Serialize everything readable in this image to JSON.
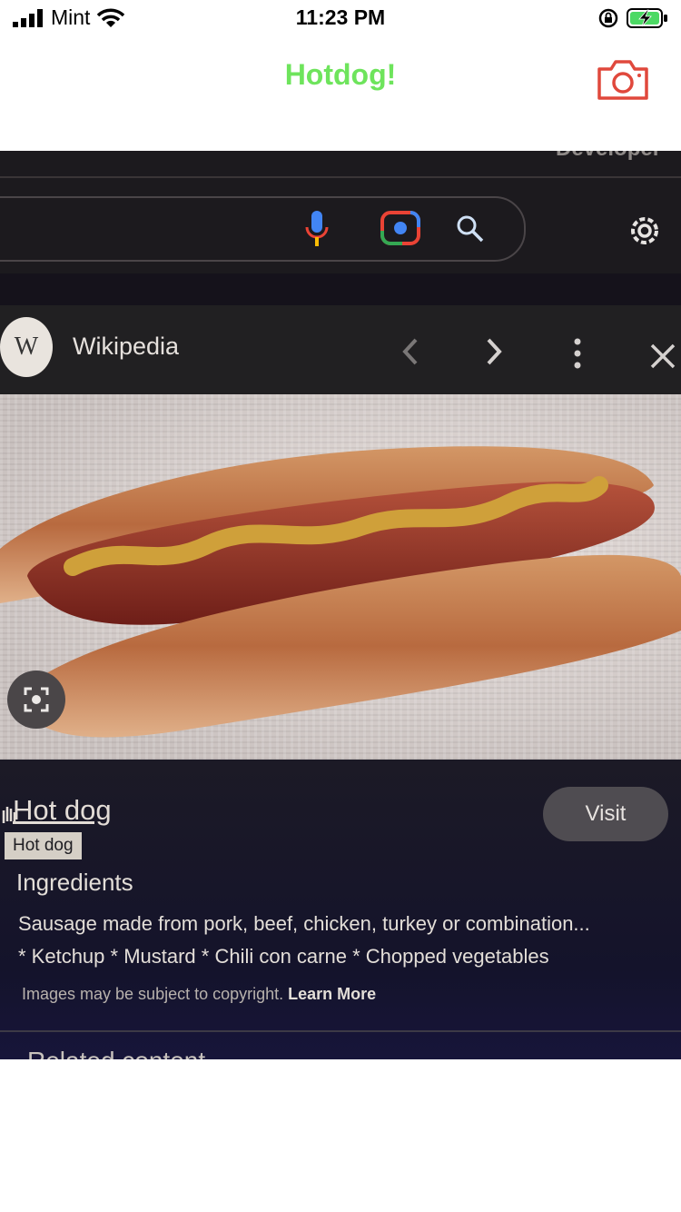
{
  "status_bar": {
    "carrier": "Mint",
    "time": "11:23 PM"
  },
  "nav": {
    "title": "Hotdog!",
    "title_color": "#6ee45c",
    "camera_icon": "camera-icon",
    "accent_color": "#e0483c"
  },
  "photo": {
    "browser_label": "Developer",
    "wiki_name": "Wikipedia",
    "wiki_logo_letter": "W",
    "result_title": "Hot dog",
    "tooltip": "Hot dog",
    "visit_label": "Visit",
    "ingredients_label": "Ingredients",
    "ingredients_line1": "Sausage made from pork, beef, chicken, turkey or combination...",
    "ingredients_line2": "* Ketchup * Mustard * Chili con carne * Chopped vegetables",
    "copyright": "Images may be subject to copyright.",
    "learn_more": "Learn More",
    "related": "Related content"
  }
}
